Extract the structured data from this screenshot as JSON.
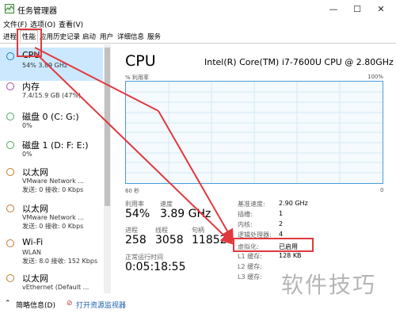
{
  "window": {
    "title": "任务管理器",
    "min": "—",
    "max": "☐",
    "close": "✕"
  },
  "menu": [
    "文件(F)",
    "选项(O)",
    "查看(V)"
  ],
  "tabs": [
    "进程",
    "性能",
    "应用历史记录",
    "启动",
    "用户",
    "详细信息",
    "服务"
  ],
  "active_tab": "性能",
  "sidebar": {
    "items": [
      {
        "title": "CPU",
        "sub": "54%  3.89 GHz",
        "sub2": "",
        "color": "#1a7fc1",
        "selected": true
      },
      {
        "title": "内存",
        "sub": "7.4/15.9 GB (47%)",
        "sub2": "",
        "color": "#a64ca6"
      },
      {
        "title": "磁盘 0 (C: G:)",
        "sub": "0%",
        "sub2": "",
        "color": "#4da760"
      },
      {
        "title": "磁盘 1 (D: F: E:)",
        "sub": "0%",
        "sub2": "",
        "color": "#4da760"
      },
      {
        "title": "以太网",
        "sub": "VMware Network ...",
        "sub2": "发送: 0 接收: 0 Kbps",
        "color": "#c5772b"
      },
      {
        "title": "以太网",
        "sub": "VMware Network ...",
        "sub2": "发送: 0 接收: 0 Kbps",
        "color": "#c5772b"
      },
      {
        "title": "Wi-Fi",
        "sub": "WLAN",
        "sub2": "发送: 8.0 接收: 152 Kbps",
        "color": "#c5772b"
      },
      {
        "title": "以太网",
        "sub": "vEthernet (Default ...",
        "sub2": "",
        "color": "#c5772b"
      }
    ]
  },
  "main": {
    "title": "CPU",
    "model": "Intel(R) Core(TM) i7-7600U CPU @ 2.80GHz",
    "graph_label": "% 利用率",
    "graph_max": "100%",
    "graph_time": "60 秒",
    "graph_min": "0",
    "stats": {
      "util_label": "利用率",
      "util": "54%",
      "speed_label": "速度",
      "speed": "3.89 GHz",
      "proc_label": "进程",
      "proc": "258",
      "thread_label": "线程",
      "thread": "3058",
      "handle_label": "句柄",
      "handle": "118527",
      "uptime_label": "正常运行时间",
      "uptime": "0:05:18:55"
    },
    "details": [
      {
        "k": "基准速度:",
        "v": "2.90 GHz"
      },
      {
        "k": "插槽:",
        "v": "1"
      },
      {
        "k": "内核:",
        "v": "2"
      },
      {
        "k": "逻辑处理器:",
        "v": "4"
      },
      {
        "k": "虚拟化:",
        "v": "已启用"
      },
      {
        "k": "L1 缓存:",
        "v": "128 KB"
      },
      {
        "k": "L2 缓存:",
        "v": ""
      },
      {
        "k": "L3 缓存:",
        "v": ""
      }
    ]
  },
  "bottom": {
    "less": "简略信息(D)",
    "monitor": "打开资源监视器"
  },
  "watermark": "软件技巧",
  "colors": {
    "accent": "#1a7fc1",
    "highlight": "#e0393e",
    "selected_bg": "#cce8ff"
  }
}
